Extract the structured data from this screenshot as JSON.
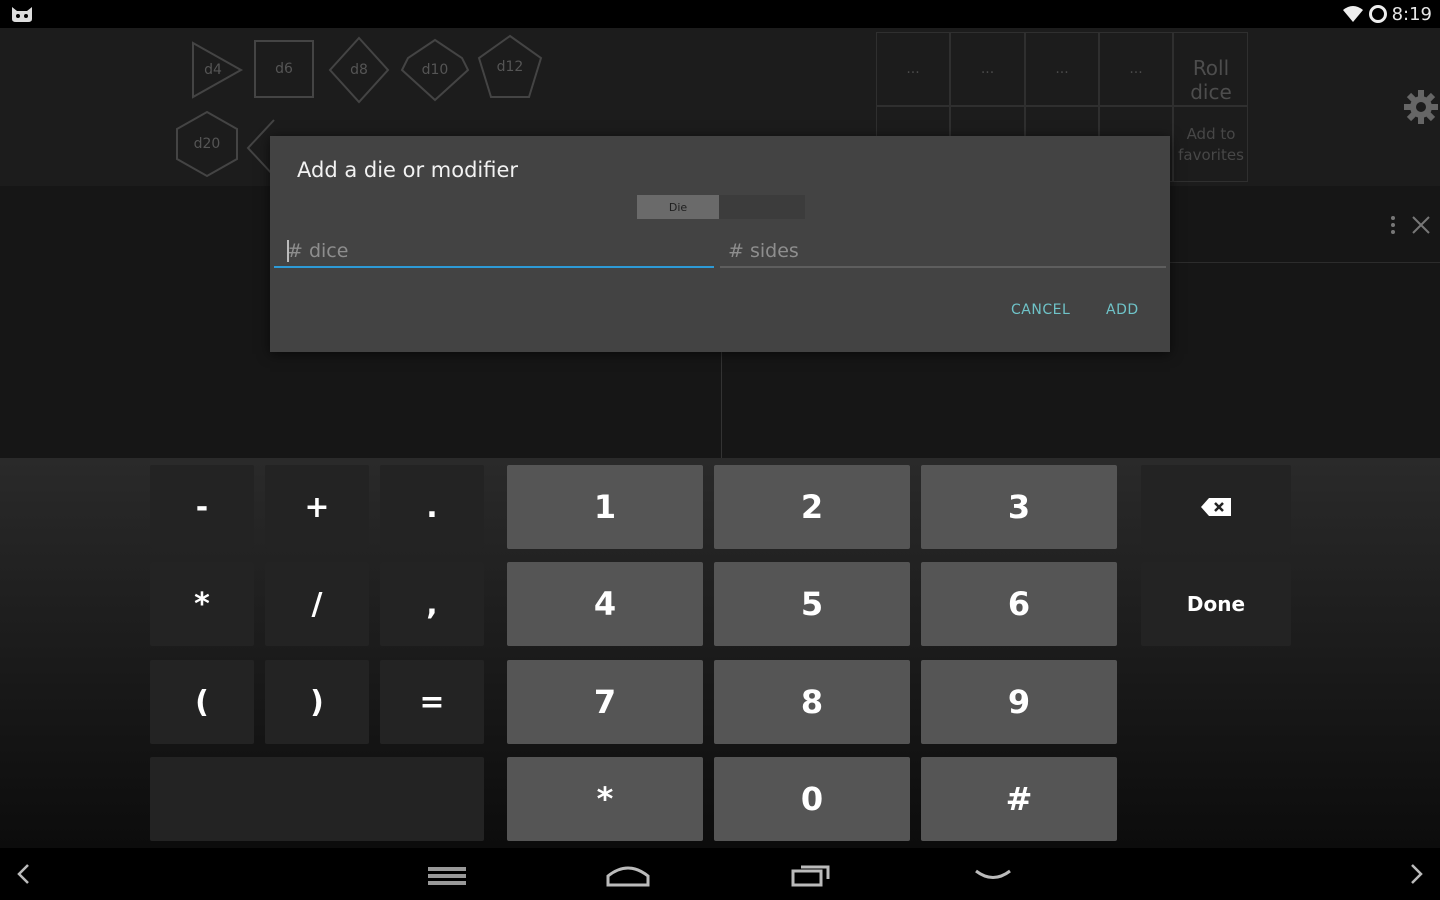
{
  "status_bar": {
    "time": "8:19",
    "left_icon": "cat-icon",
    "icons": [
      "wifi-icon",
      "sync-icon"
    ]
  },
  "dice_palette": {
    "row1": [
      "d4",
      "d6",
      "d8",
      "d10",
      "d12"
    ],
    "row2": [
      "d20"
    ]
  },
  "favorites": {
    "cells": [
      "...",
      "...",
      "...",
      "..."
    ],
    "roll_label": "Roll dice",
    "add_label_line1": "Add to",
    "add_label_line2": "favorites"
  },
  "dialog": {
    "title": "Add a die or modifier",
    "tab_die": "Die",
    "dice_placeholder": "# dice",
    "dice_value": "",
    "sides_placeholder": "# sides",
    "sides_value": "",
    "cancel_label": "CANCEL",
    "add_label": "ADD"
  },
  "keyboard": {
    "k_minus": "-",
    "k_plus": "+",
    "k_dot": ".",
    "k_star": "*",
    "k_slash": "/",
    "k_comma": ",",
    "k_lparen": "(",
    "k_rparen": ")",
    "k_equals": "=",
    "k_1": "1",
    "k_2": "2",
    "k_3": "3",
    "k_4": "4",
    "k_5": "5",
    "k_6": "6",
    "k_7": "7",
    "k_8": "8",
    "k_9": "9",
    "k_star2": "*",
    "k_0": "0",
    "k_hash": "#",
    "k_done": "Done",
    "k_backspace_icon": "backspace-icon"
  },
  "nav_bar": {
    "icons": [
      "chevron-left-icon",
      "menu-icon",
      "home-icon",
      "recents-icon",
      "hide-keyboard-icon",
      "chevron-right-icon"
    ]
  }
}
